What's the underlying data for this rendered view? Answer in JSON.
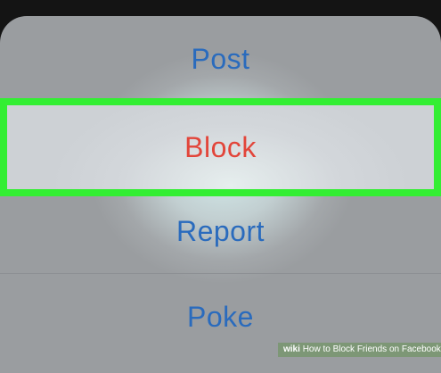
{
  "action_sheet": {
    "options": [
      {
        "label": "Post"
      },
      {
        "label": "Block"
      },
      {
        "label": "Report"
      },
      {
        "label": "Poke"
      }
    ]
  },
  "colors": {
    "action_blue": "#2a6bbd",
    "destructive_red": "#e2453a",
    "highlight_green": "#33ee33"
  },
  "watermark": {
    "brand": "wiki",
    "text": "How to Block Friends on Facebook"
  }
}
